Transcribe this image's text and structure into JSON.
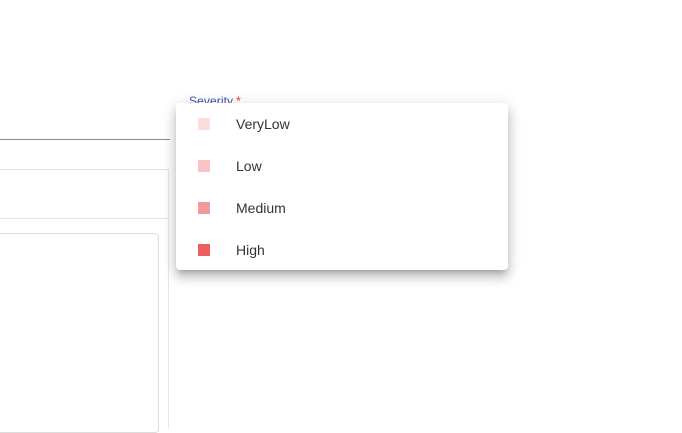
{
  "severity_field": {
    "label": "Severity",
    "required_marker": "*"
  },
  "severity_menu": {
    "options": [
      {
        "label": "VeryLow",
        "color": "#fddcdc"
      },
      {
        "label": "Low",
        "color": "#f9c4c4"
      },
      {
        "label": "Medium",
        "color": "#f29a9a"
      },
      {
        "label": "High",
        "color": "#ec5f5f"
      }
    ]
  },
  "info_icon": {
    "name": "info-icon"
  }
}
